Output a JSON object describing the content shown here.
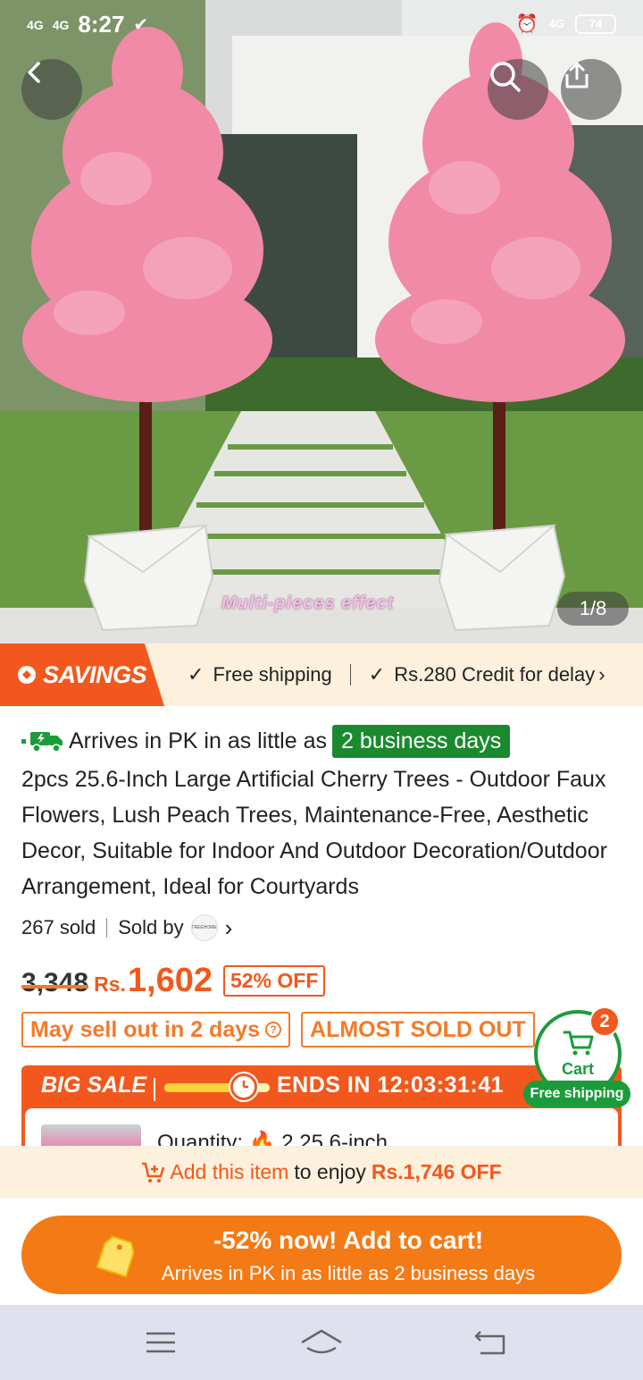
{
  "status_bar": {
    "net1": "4G",
    "net2": "4G",
    "time": "8:27",
    "net3": "4G",
    "battery": "74"
  },
  "hero": {
    "overlay_caption": "Multi-pieces effect",
    "pager": "1/8"
  },
  "savings": {
    "badge": "SAVINGS",
    "item1": "Free shipping",
    "item2": "Rs.280 Credit for delay"
  },
  "delivery": {
    "prefix": "Arrives in PK in as little as",
    "highlight": "2 business days"
  },
  "product": {
    "title": "2pcs 25.6-Inch Large Artificial Cherry Trees - Outdoor Faux Flowers, Lush Peach Trees, Maintenance-Free, Aesthetic Decor, Suitable for Indoor And Outdoor Decoration/Outdoor Arrangement, Ideal for Courtyards",
    "sold_count": "267 sold",
    "sold_by_label": "Sold by",
    "seller_logo_text": "TREEHOME"
  },
  "price": {
    "old": "3,348",
    "currency": "Rs.",
    "new": "1,602",
    "discount": "52% OFF"
  },
  "tags": {
    "sell_out": "May sell out in 2 days",
    "almost_sold": "ALMOST SOLD OUT"
  },
  "big_sale": {
    "label": "BIG SALE",
    "ends_label": "ENDS IN",
    "countdown": "12:03:31:41",
    "quantity_text": "Quantity: 🔥 2 25.6-inch",
    "progress": 0.75
  },
  "cart": {
    "count": "2",
    "label": "Cart",
    "free_shipping": "Free shipping"
  },
  "promo": {
    "add_text": "Add this item",
    "middle": "to enjoy",
    "amount": "Rs.1,746 OFF"
  },
  "cta": {
    "main": "-52% now! Add to cart!",
    "sub": "Arrives in PK in as little as 2 business days"
  },
  "colors": {
    "accent": "#f2581d",
    "green": "#1b9c3a",
    "cta": "#f47a16"
  }
}
